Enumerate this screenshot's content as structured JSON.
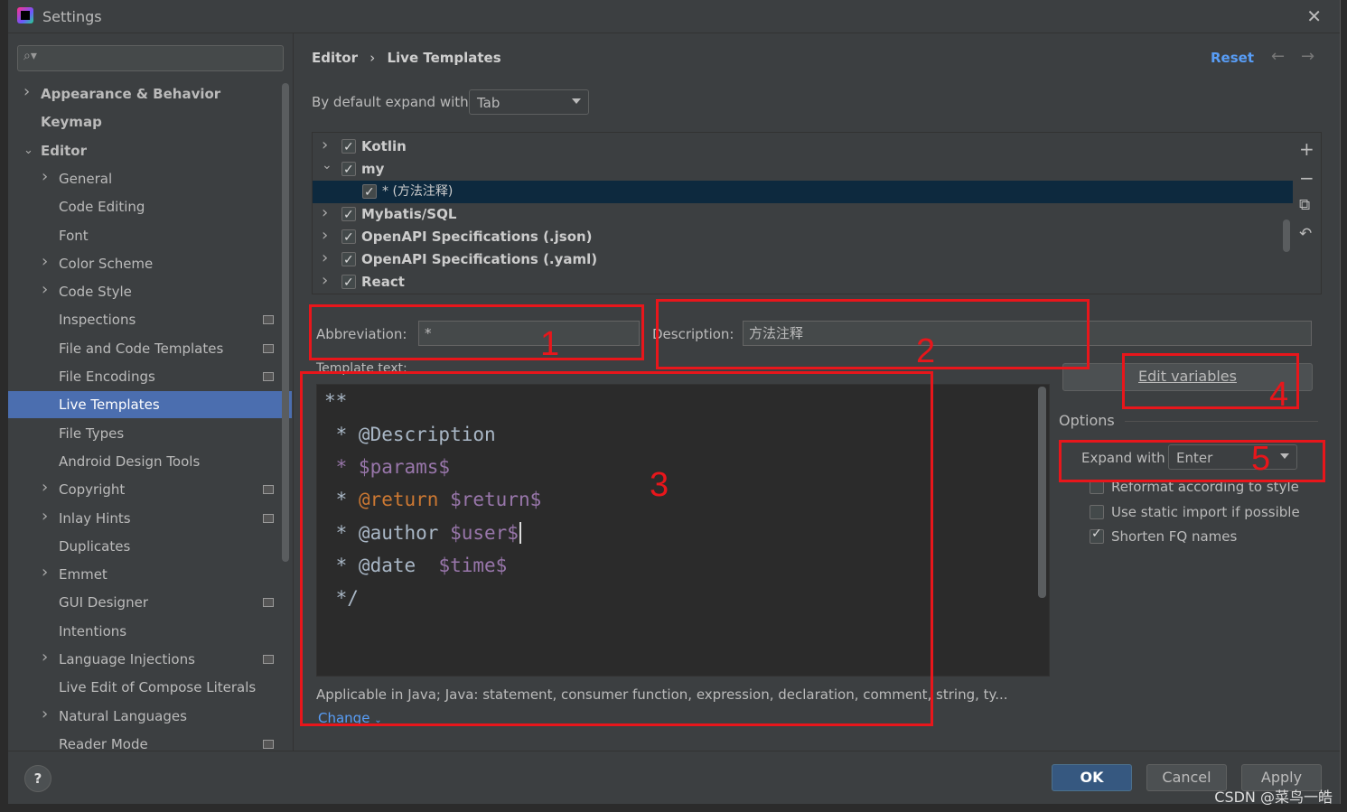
{
  "window": {
    "title": "Settings"
  },
  "search": {
    "placeholder": ""
  },
  "sidebar": {
    "items": [
      {
        "label": "Appearance & Behavior",
        "bold": true,
        "chevron": "right"
      },
      {
        "label": "Keymap",
        "bold": true,
        "chevron": ""
      },
      {
        "label": "Editor",
        "bold": true,
        "chevron": "down"
      },
      {
        "label": "General",
        "chevron": "right"
      },
      {
        "label": "Code Editing"
      },
      {
        "label": "Font"
      },
      {
        "label": "Color Scheme",
        "chevron": "right"
      },
      {
        "label": "Code Style",
        "chevron": "right"
      },
      {
        "label": "Inspections",
        "project_icon": true
      },
      {
        "label": "File and Code Templates",
        "project_icon": true
      },
      {
        "label": "File Encodings",
        "project_icon": true
      },
      {
        "label": "Live Templates",
        "selected": true
      },
      {
        "label": "File Types"
      },
      {
        "label": "Android Design Tools"
      },
      {
        "label": "Copyright",
        "chevron": "right",
        "project_icon": true
      },
      {
        "label": "Inlay Hints",
        "chevron": "right",
        "project_icon": true
      },
      {
        "label": "Duplicates"
      },
      {
        "label": "Emmet",
        "chevron": "right"
      },
      {
        "label": "GUI Designer",
        "project_icon": true
      },
      {
        "label": "Intentions"
      },
      {
        "label": "Language Injections",
        "chevron": "right",
        "project_icon": true
      },
      {
        "label": "Live Edit of Compose Literals"
      },
      {
        "label": "Natural Languages",
        "chevron": "right"
      },
      {
        "label": "Reader Mode",
        "project_icon": true
      }
    ]
  },
  "breadcrumb": {
    "parent": "Editor",
    "separator": "›",
    "current": "Live Templates"
  },
  "header": {
    "reset": "Reset",
    "back_icon": "arrow-left-icon",
    "forward_icon": "arrow-right-icon"
  },
  "expand_default": {
    "label": "By default expand with",
    "value": "Tab"
  },
  "templates": [
    {
      "label": "Kotlin",
      "checked": true,
      "chevron": "right",
      "level": 0
    },
    {
      "label": "my",
      "checked": true,
      "chevron": "down",
      "level": 0
    },
    {
      "label": "* (方法注释)",
      "checked": true,
      "chevron": "",
      "level": 1,
      "selected": true
    },
    {
      "label": "Mybatis/SQL",
      "checked": true,
      "chevron": "right",
      "level": 0
    },
    {
      "label": "OpenAPI Specifications (.json)",
      "checked": true,
      "chevron": "right",
      "level": 0
    },
    {
      "label": "OpenAPI Specifications (.yaml)",
      "checked": true,
      "chevron": "right",
      "level": 0
    },
    {
      "label": "React",
      "checked": true,
      "chevron": "right",
      "level": 0
    }
  ],
  "tools": {
    "add": "+",
    "remove": "−",
    "copy": "⧉",
    "restore": "↶"
  },
  "abbreviation": {
    "label": "Abbreviation:",
    "value": "*"
  },
  "description": {
    "label": "Description:",
    "value": "方法注释"
  },
  "template_text": {
    "label": "Template text:",
    "lines": [
      "**",
      " * @Description",
      " * $params$",
      " * @return $return$",
      " * @author $user$",
      " * @date  $time$",
      " */"
    ]
  },
  "applicable": {
    "text": "Applicable in Java; Java: statement, consumer function, expression, declaration, comment, string, ty...",
    "change": "Change"
  },
  "edit_variables": "Edit variables",
  "options": {
    "title": "Options",
    "expand_with_label": "Expand with",
    "expand_with_value": "Enter",
    "reformat": {
      "label": "Reformat according to style",
      "checked": false
    },
    "static_import": {
      "label": "Use static import if possible",
      "checked": false
    },
    "shorten_fq": {
      "label": "Shorten FQ names",
      "checked": true
    }
  },
  "annotations": [
    "1",
    "2",
    "3",
    "4",
    "5"
  ],
  "buttons": {
    "ok": "OK",
    "cancel": "Cancel",
    "apply": "Apply",
    "help": "?"
  },
  "watermark": "CSDN @菜鸟一皓",
  "colors": {
    "accent": "#4b6eaf",
    "link": "#589df6",
    "annotation": "#e8161b",
    "selected_row": "#0d293e"
  }
}
